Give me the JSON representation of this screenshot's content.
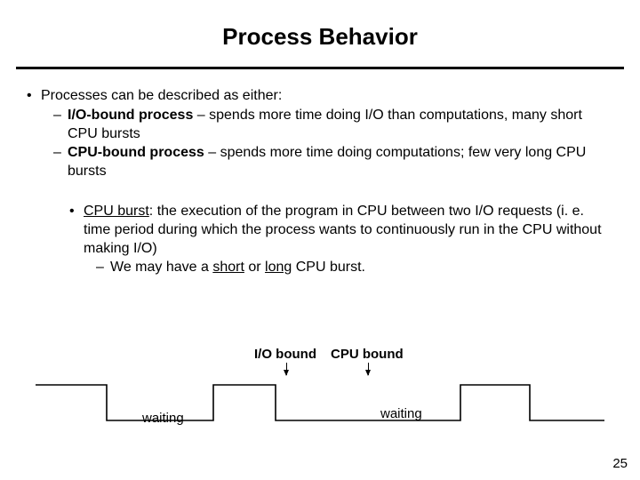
{
  "title": "Process Behavior",
  "bullets": {
    "p1": "Processes can be described as either:",
    "io_bold": "I/O-bound process",
    "io_rest": " – spends more time doing I/O than computations, many short CPU bursts",
    "cpu_bold": "CPU-bound process",
    "cpu_rest": " – spends more time doing computations; few very long CPU bursts",
    "burst_ul": "CPU burst",
    "burst_rest": ": the execution of the program in CPU between two I/O requests (i. e. time period during which the process wants to continuously run in the CPU without making I/O)",
    "may_pre": "We may have a ",
    "may_s": "short",
    "may_mid": " or ",
    "may_l": "long",
    "may_post": " CPU burst."
  },
  "labels": {
    "io": "I/O bound",
    "cpu": "CPU bound",
    "wait1": "waiting",
    "wait2": "waiting"
  },
  "page_number": "25"
}
